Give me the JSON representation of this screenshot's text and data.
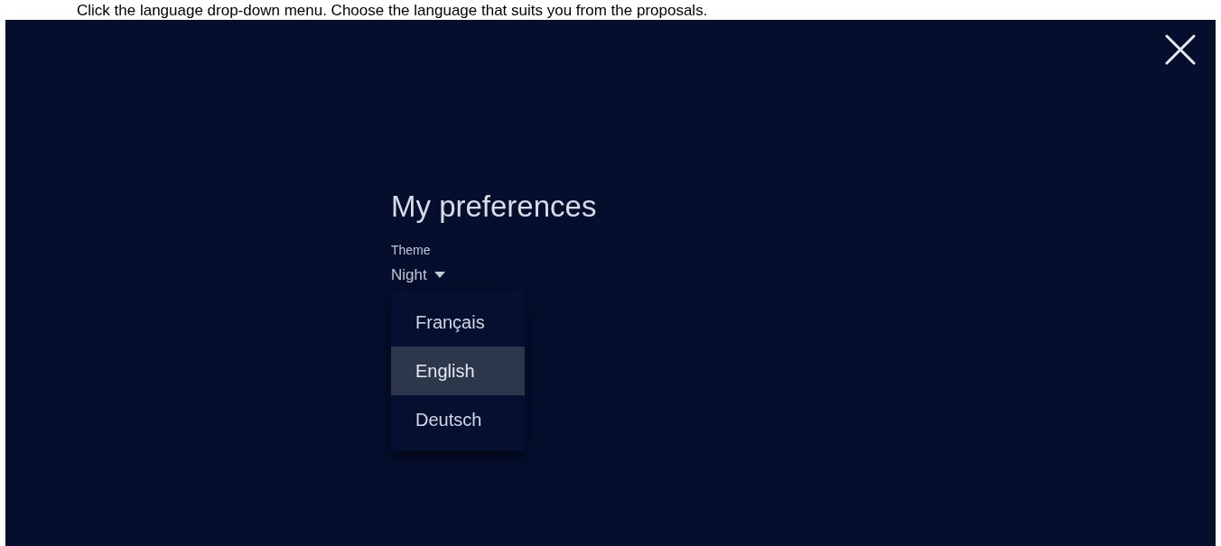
{
  "instruction": "Click the language drop-down menu. Choose the language that suits you from the proposals.",
  "title": "My preferences",
  "theme": {
    "label": "Theme",
    "value": "Night"
  },
  "language_menu": [
    {
      "label": "Français",
      "selected": false
    },
    {
      "label": "English",
      "selected": true
    },
    {
      "label": "Deutsch",
      "selected": false
    }
  ]
}
